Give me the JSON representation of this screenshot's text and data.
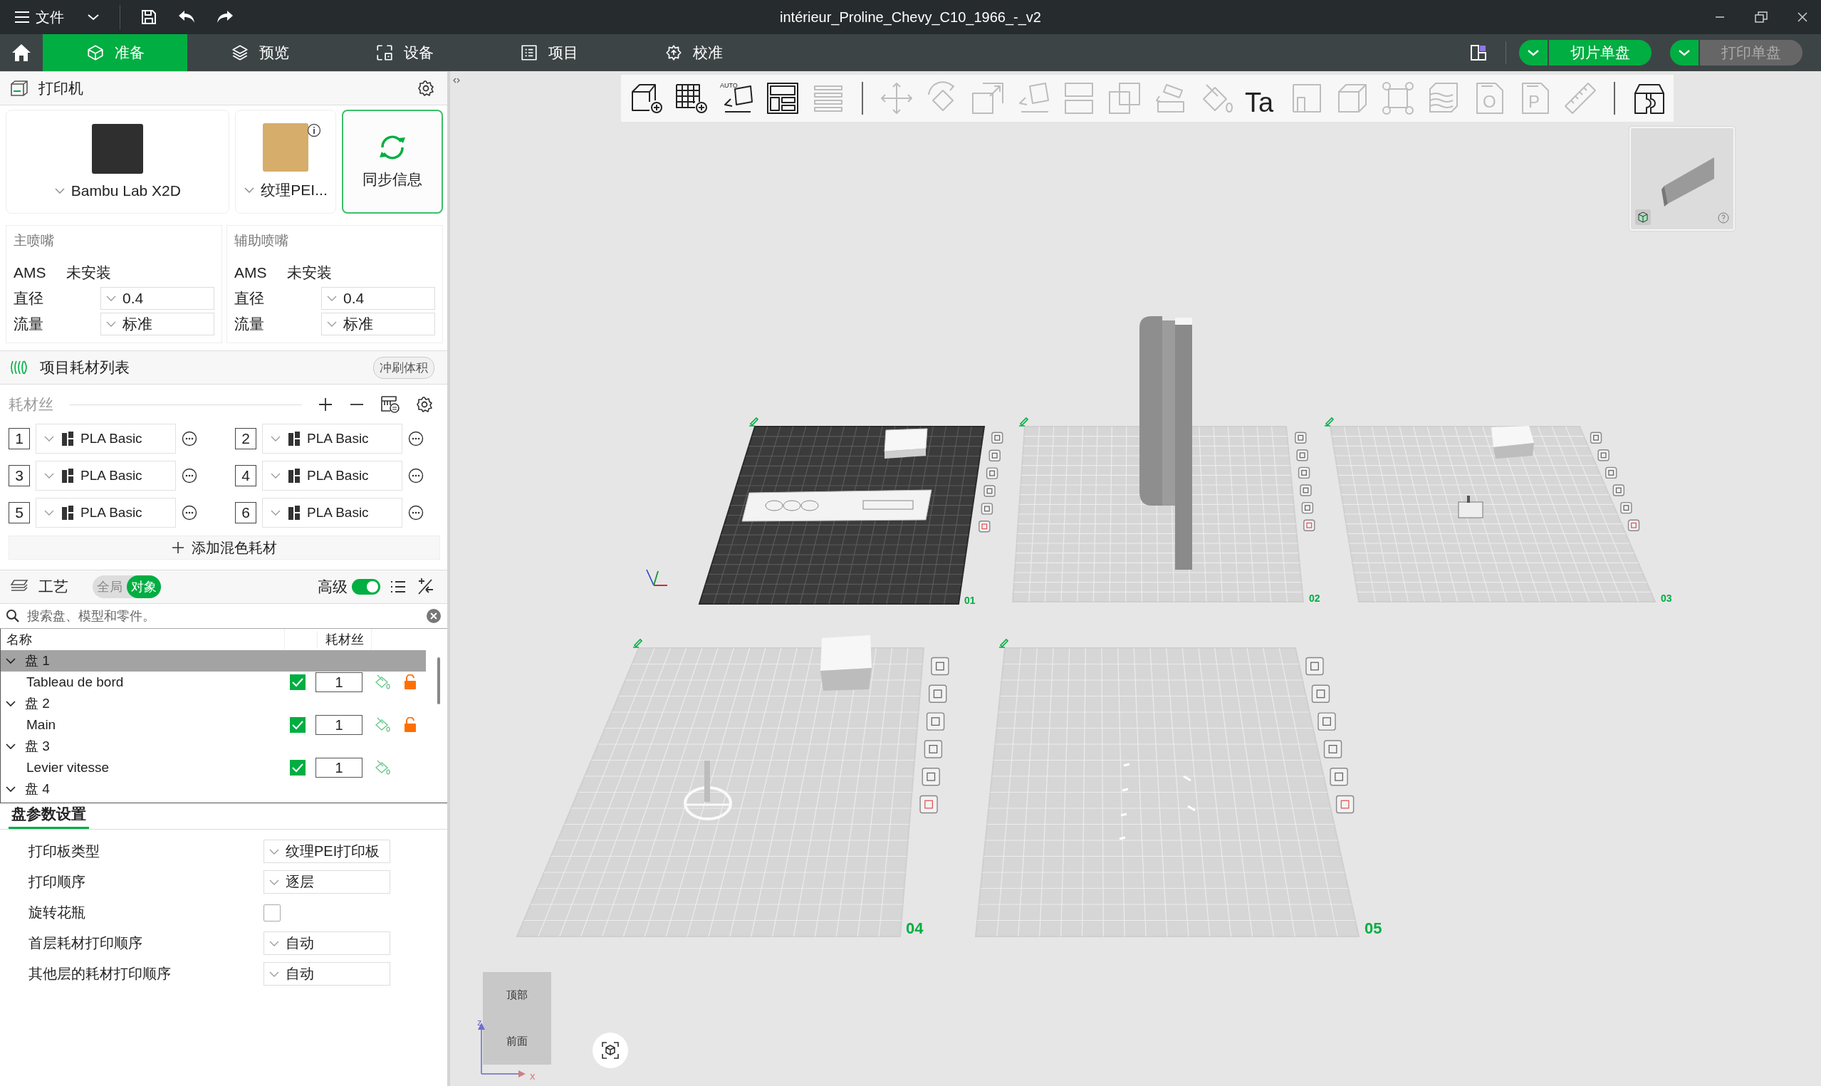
{
  "title_bar": {
    "menu": "文件",
    "title": "intérieur_Proline_Chevy_C10_1966_-_v2"
  },
  "tabs": [
    {
      "label": "准备",
      "kind": "prepare",
      "selected": true
    },
    {
      "label": "预览",
      "kind": "preview",
      "selected": false
    },
    {
      "label": "设备",
      "kind": "device",
      "selected": false
    },
    {
      "label": "项目",
      "kind": "project",
      "selected": false
    },
    {
      "label": "校准",
      "kind": "calibration",
      "selected": false
    }
  ],
  "actions": [
    {
      "label": "切片单盘",
      "disabled": false
    },
    {
      "label": "打印单盘",
      "disabled": true
    }
  ],
  "printer": {
    "title": "打印机",
    "model": "Bambu Lab X2D",
    "plate": "纹理PEI...",
    "sync": "同步信息"
  },
  "nozzles": [
    {
      "title": "主喷嘴",
      "ams_label": "AMS",
      "ams_value": "未安装",
      "diameter_label": "直径",
      "diameter": "0.4",
      "flow_label": "流量",
      "flow": "标准"
    },
    {
      "title": "辅助喷嘴",
      "ams_label": "AMS",
      "ams_value": "未安装",
      "diameter_label": "直径",
      "diameter": "0.4",
      "flow_label": "流量",
      "flow": "标准"
    }
  ],
  "filaments": {
    "title": "项目耗材列表",
    "flush_button": "冲刷体积",
    "subtitle": "耗材丝",
    "add_mixed": "添加混色耗材",
    "items": [
      {
        "index": "1",
        "name": "PLA Basic"
      },
      {
        "index": "2",
        "name": "PLA Basic"
      },
      {
        "index": "3",
        "name": "PLA Basic"
      },
      {
        "index": "4",
        "name": "PLA Basic"
      },
      {
        "index": "5",
        "name": "PLA Basic"
      },
      {
        "index": "6",
        "name": "PLA Basic"
      }
    ]
  },
  "process": {
    "title": "工艺",
    "modes": [
      {
        "label": "全局",
        "selected": false
      },
      {
        "label": "对象",
        "selected": true
      }
    ],
    "advanced_label": "高级",
    "advanced_on": true,
    "search_placeholder": "搜索盘、模型和零件。",
    "columns": [
      "名称",
      "耗材丝"
    ],
    "plates": [
      {
        "name": "盘 1",
        "expanded": true,
        "selected": true,
        "children": [
          {
            "name": "Tableau de bord",
            "printable": true,
            "filament": "1",
            "custom_settings": true
          }
        ]
      },
      {
        "name": "盘 2",
        "expanded": true,
        "selected": false,
        "children": [
          {
            "name": "Main",
            "printable": true,
            "filament": "1",
            "custom_settings": true
          }
        ]
      },
      {
        "name": "盘 3",
        "expanded": true,
        "selected": false,
        "children": [
          {
            "name": "Levier vitesse",
            "printable": true,
            "filament": "1",
            "custom_settings": false
          }
        ]
      },
      {
        "name": "盘 4",
        "expanded": true,
        "selected": false
      }
    ]
  },
  "plate_settings": {
    "tab": "盘参数设置",
    "rows": [
      {
        "kind": "select",
        "label": "打印板类型",
        "value": "纹理PEI打印板"
      },
      {
        "kind": "select",
        "label": "打印顺序",
        "value": "逐层"
      },
      {
        "kind": "checkbox",
        "label": "旋转花瓶",
        "checked": false
      },
      {
        "kind": "select",
        "label": "首层耗材打印顺序",
        "value": "自动"
      },
      {
        "kind": "select",
        "label": "其他层的耗材打印顺序",
        "value": "自动"
      }
    ]
  },
  "viewport": {
    "toolbar": [
      {
        "kind": "add-cube",
        "disabled": false
      },
      {
        "kind": "add-plate",
        "disabled": false
      },
      {
        "kind": "auto-orient",
        "label": "AUTO",
        "disabled": false
      },
      {
        "kind": "arrange",
        "disabled": false
      },
      {
        "kind": "layers",
        "disabled": true
      },
      {
        "kind": "separator"
      },
      {
        "kind": "move",
        "disabled": true
      },
      {
        "kind": "rotate",
        "disabled": true
      },
      {
        "kind": "scale",
        "disabled": true
      },
      {
        "kind": "lay-flat",
        "disabled": true
      },
      {
        "kind": "cut",
        "disabled": true
      },
      {
        "kind": "boolean",
        "disabled": true
      },
      {
        "kind": "support",
        "disabled": true
      },
      {
        "kind": "paint",
        "disabled": true
      },
      {
        "kind": "text",
        "label": "Ta",
        "disabled": false
      },
      {
        "kind": "seam",
        "disabled": true
      },
      {
        "kind": "cube",
        "disabled": true
      },
      {
        "kind": "assembly",
        "disabled": true
      },
      {
        "kind": "variable-layer",
        "disabled": true
      },
      {
        "kind": "part",
        "label": "O",
        "disabled": true
      },
      {
        "kind": "part",
        "label": "P",
        "disabled": true
      },
      {
        "kind": "ruler",
        "disabled": true
      },
      {
        "kind": "separator"
      },
      {
        "kind": "split",
        "disabled": false
      }
    ],
    "plates": [
      {
        "number": "01",
        "selected": true
      },
      {
        "number": "02",
        "selected": false
      },
      {
        "number": "03",
        "selected": false
      },
      {
        "number": "04",
        "selected": false
      },
      {
        "number": "05",
        "selected": false
      }
    ],
    "view_cube": {
      "top": "顶部",
      "front": "前面",
      "axis_x": "x",
      "axis_z": "z"
    }
  }
}
